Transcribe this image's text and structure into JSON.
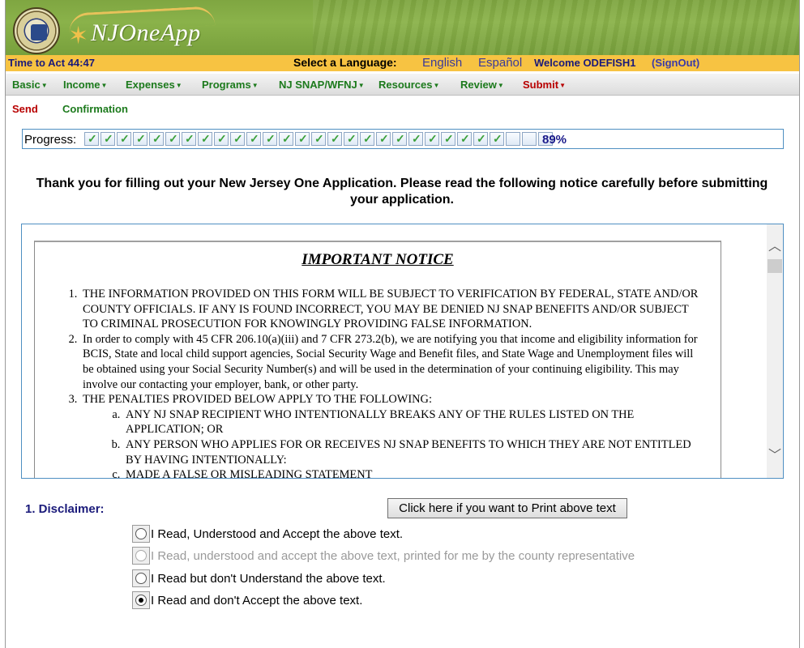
{
  "app": {
    "brand": "NJOneApp"
  },
  "status": {
    "timer": "Time to Act 44:47",
    "language_label": "Select a Language:",
    "languages": [
      "English",
      "Español"
    ],
    "welcome": "Welcome ODEFISH1",
    "signout": "(SignOut)"
  },
  "nav": {
    "items": [
      {
        "label": "Basic"
      },
      {
        "label": "Income"
      },
      {
        "label": "Expenses"
      },
      {
        "label": "Programs"
      },
      {
        "label": "NJ SNAP/WFNJ"
      },
      {
        "label": "Resources"
      },
      {
        "label": "Review"
      },
      {
        "label": "Submit"
      }
    ],
    "subitems": [
      {
        "label": "Send"
      },
      {
        "label": "Confirmation"
      }
    ]
  },
  "progress": {
    "label": "Progress:",
    "percent_text": "89%",
    "completed_steps": 26,
    "total_steps": 29
  },
  "intro": {
    "text": "Thank you for filling out your New Jersey One Application. Please read the following notice carefully before submitting your application."
  },
  "notice": {
    "title": "IMPORTANT NOTICE",
    "items": [
      "THE INFORMATION PROVIDED ON THIS FORM WILL BE SUBJECT TO VERIFICATION BY FEDERAL, STATE AND/OR COUNTY OFFICIALS. IF ANY IS FOUND INCORRECT, YOU MAY BE DENIED NJ SNAP BENEFITS AND/OR SUBJECT TO CRIMINAL PROSECUTION FOR KNOWINGLY PROVIDING FALSE INFORMATION.",
      "In order to comply with 45 CFR 206.10(a)(iii) and 7 CFR 273.2(b), we are notifying you that income and eligibility information for BCIS, State and local child support agencies, Social Security Wage and Benefit files, and State Wage and Unemployment files will be obtained using your Social Security Number(s) and will be used in the determination of your continuing eligibility. This may involve our contacting your employer, bank, or other party.",
      "THE PENALTIES PROVIDED BELOW APPLY TO THE FOLLOWING:"
    ],
    "subitems": [
      "ANY NJ SNAP RECIPIENT WHO INTENTIONALLY BREAKS ANY OF THE RULES LISTED ON THE APPLICATION; OR",
      "ANY PERSON WHO APPLIES FOR OR RECEIVES NJ SNAP BENEFITS TO WHICH THEY ARE NOT ENTITLED BY HAVING INTENTIONALLY:",
      "MADE A FALSE OR MISLEADING STATEMENT"
    ]
  },
  "disclaimer": {
    "label": "1. Disclaimer:",
    "print_button": "Click here if you want to Print above text",
    "options": [
      {
        "label": "I Read, Understood and Accept the above text.",
        "checked": false,
        "disabled": false
      },
      {
        "label": "I Read, understood and accept the above text, printed for me by the county representative",
        "checked": false,
        "disabled": true
      },
      {
        "label": "I Read but don't Understand the above text.",
        "checked": false,
        "disabled": false
      },
      {
        "label": "I Read and don't Accept the above text.",
        "checked": true,
        "disabled": false
      }
    ]
  },
  "colors": {
    "banner_green": "#8ab24a",
    "status_yellow": "#f7c342",
    "nav_green": "#1c7a1c",
    "nav_active_red": "#b80000",
    "frame_blue": "#4f8fc2"
  }
}
